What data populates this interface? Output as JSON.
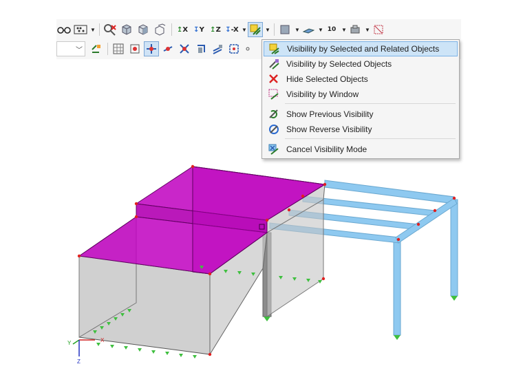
{
  "toolbar": {
    "row1_axis_labels": [
      "X",
      "Y",
      "Z",
      "-X"
    ],
    "dimension_label": "10"
  },
  "visibility_menu": {
    "items": [
      {
        "label": "Visibility by Selected and Related Objects",
        "icon": "visibility-related-icon",
        "highlighted": true
      },
      {
        "label": "Visibility by Selected Objects",
        "icon": "visibility-selected-icon"
      },
      {
        "label": "Hide Selected Objects",
        "icon": "hide-selected-icon"
      },
      {
        "label": "Visibility by Window",
        "icon": "visibility-window-icon"
      },
      {
        "label": "Show Previous Visibility",
        "icon": "previous-visibility-icon"
      },
      {
        "label": "Show Reverse Visibility",
        "icon": "reverse-visibility-icon"
      },
      {
        "label": "Cancel Visibility Mode",
        "icon": "cancel-visibility-icon"
      }
    ]
  },
  "model_view": {
    "axis_labels": {
      "x": "X",
      "y": "Y",
      "z": "Z"
    },
    "colors": {
      "selected_surface": "#c000c0",
      "wall_surface": "#c8c8c8",
      "member": "#8ec9f0",
      "support": "#3fbf3f",
      "node": "#e02020"
    }
  }
}
